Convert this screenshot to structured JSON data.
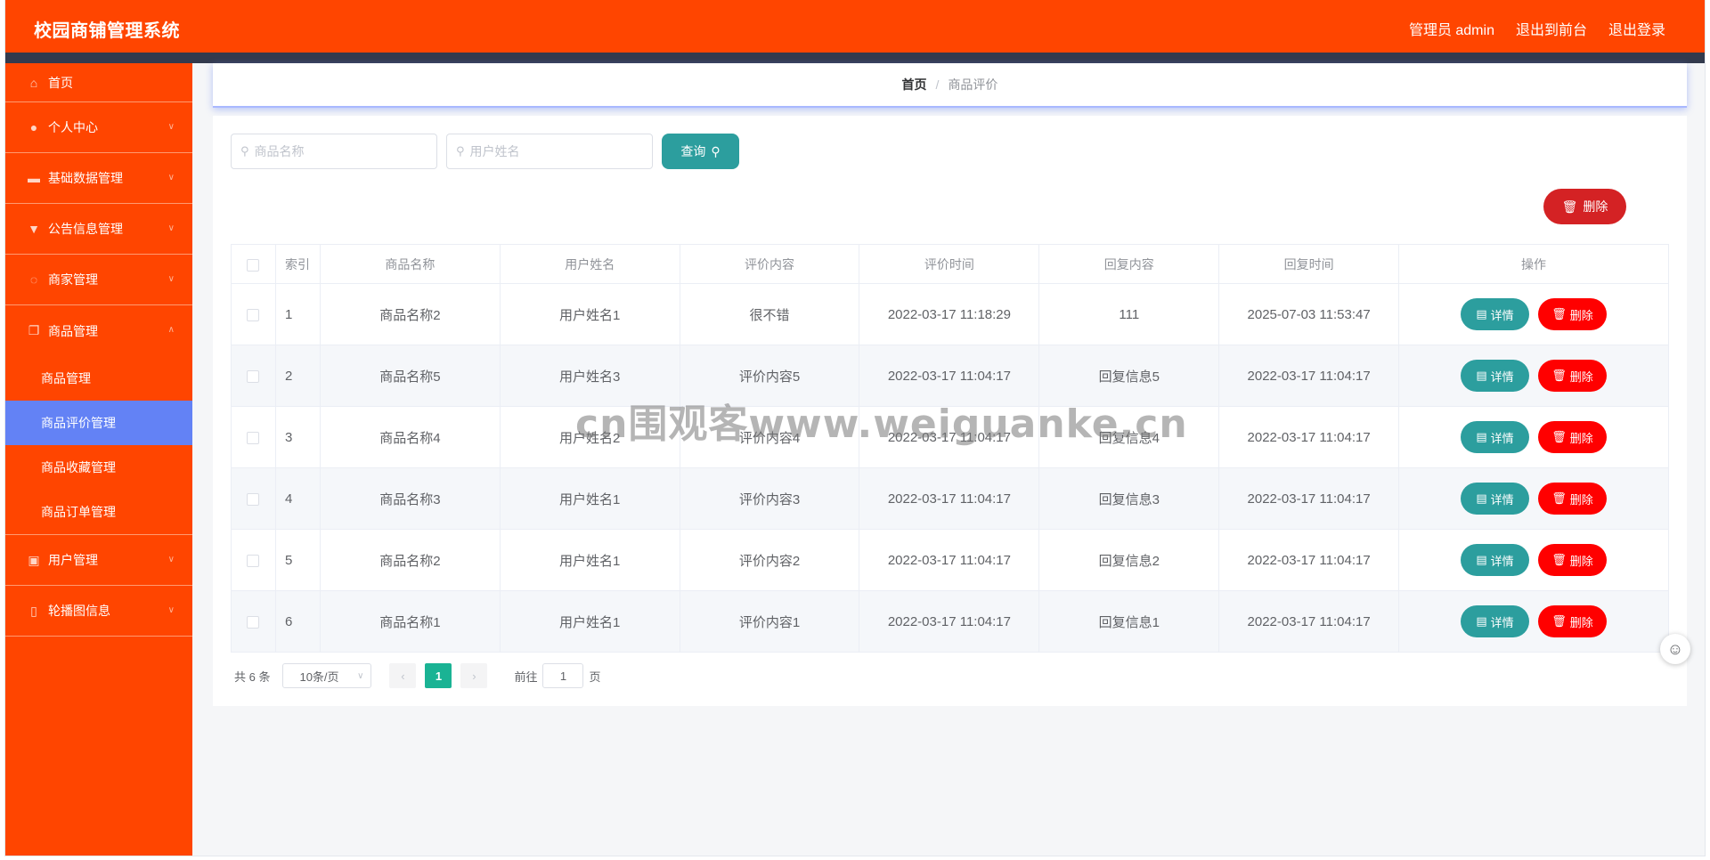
{
  "header": {
    "title": "校园商铺管理系统",
    "admin": "管理员 admin",
    "to_front": "退出到前台",
    "logout": "退出登录"
  },
  "sidebar": {
    "items": [
      {
        "label": "首页"
      },
      {
        "label": "个人中心"
      },
      {
        "label": "基础数据管理"
      },
      {
        "label": "公告信息管理"
      },
      {
        "label": "商家管理"
      },
      {
        "label": "商品管理"
      },
      {
        "label": "用户管理"
      },
      {
        "label": "轮播图信息"
      }
    ],
    "sub_items": [
      {
        "label": "商品管理"
      },
      {
        "label": "商品评价管理"
      },
      {
        "label": "商品收藏管理"
      },
      {
        "label": "商品订单管理"
      }
    ]
  },
  "breadcrumb": {
    "home": "首页",
    "sep": "/",
    "current": "商品评价"
  },
  "search": {
    "goods_placeholder": "商品名称",
    "user_placeholder": "用户姓名",
    "query_label": "查询"
  },
  "actions": {
    "delete_label": "删除"
  },
  "table": {
    "columns": [
      "索引",
      "商品名称",
      "用户姓名",
      "评价内容",
      "评价时间",
      "回复内容",
      "回复时间",
      "操作"
    ],
    "rows": [
      {
        "index": "1",
        "goods": "商品名称2",
        "user": "用户姓名1",
        "content": "很不错",
        "time": "2022-03-17 11:18:29",
        "reply": "111",
        "reply_time": "2025-07-03 11:53:47"
      },
      {
        "index": "2",
        "goods": "商品名称5",
        "user": "用户姓名3",
        "content": "评价内容5",
        "time": "2022-03-17 11:04:17",
        "reply": "回复信息5",
        "reply_time": "2022-03-17 11:04:17"
      },
      {
        "index": "3",
        "goods": "商品名称4",
        "user": "用户姓名2",
        "content": "评价内容4",
        "time": "2022-03-17 11:04:17",
        "reply": "回复信息4",
        "reply_time": "2022-03-17 11:04:17"
      },
      {
        "index": "4",
        "goods": "商品名称3",
        "user": "用户姓名1",
        "content": "评价内容3",
        "time": "2022-03-17 11:04:17",
        "reply": "回复信息3",
        "reply_time": "2022-03-17 11:04:17"
      },
      {
        "index": "5",
        "goods": "商品名称2",
        "user": "用户姓名1",
        "content": "评价内容2",
        "time": "2022-03-17 11:04:17",
        "reply": "回复信息2",
        "reply_time": "2022-03-17 11:04:17"
      },
      {
        "index": "6",
        "goods": "商品名称1",
        "user": "用户姓名1",
        "content": "评价内容1",
        "time": "2022-03-17 11:04:17",
        "reply": "回复信息1",
        "reply_time": "2022-03-17 11:04:17"
      }
    ],
    "detail_label": "详情",
    "delete_label": "删除"
  },
  "pager": {
    "total": "共 6 条",
    "page_size": "10条/页",
    "current_page": "1",
    "goto_prefix": "前往",
    "goto_value": "1",
    "goto_suffix": "页"
  },
  "watermark": "cn围观客www.weiguanke.cn",
  "colors": {
    "brand": "#ff4500",
    "active": "#6382f5",
    "teal": "#2c9e9e",
    "danger": "#ff0000"
  }
}
